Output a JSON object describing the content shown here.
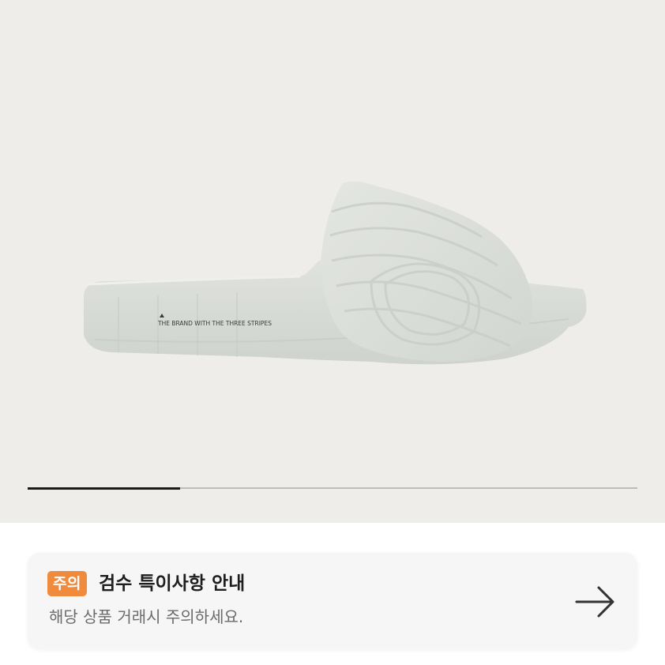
{
  "product": {
    "image_alt": "White slide sandal",
    "sandal_print": "THE BRAND WITH THE THREE STRIPES",
    "carousel_progress": 0.25
  },
  "notice": {
    "badge": "주의",
    "title": "검수 특이사항 안내",
    "description": "해당 상품 거래시 주의하세요.",
    "arrow_icon": "arrow-right-icon"
  },
  "colors": {
    "image_background": "#efede9",
    "badge_orange": "#f08b3e",
    "card_background": "#f6f6f6",
    "progress_active": "#1a1a1a",
    "progress_track": "#bdbcb8"
  }
}
